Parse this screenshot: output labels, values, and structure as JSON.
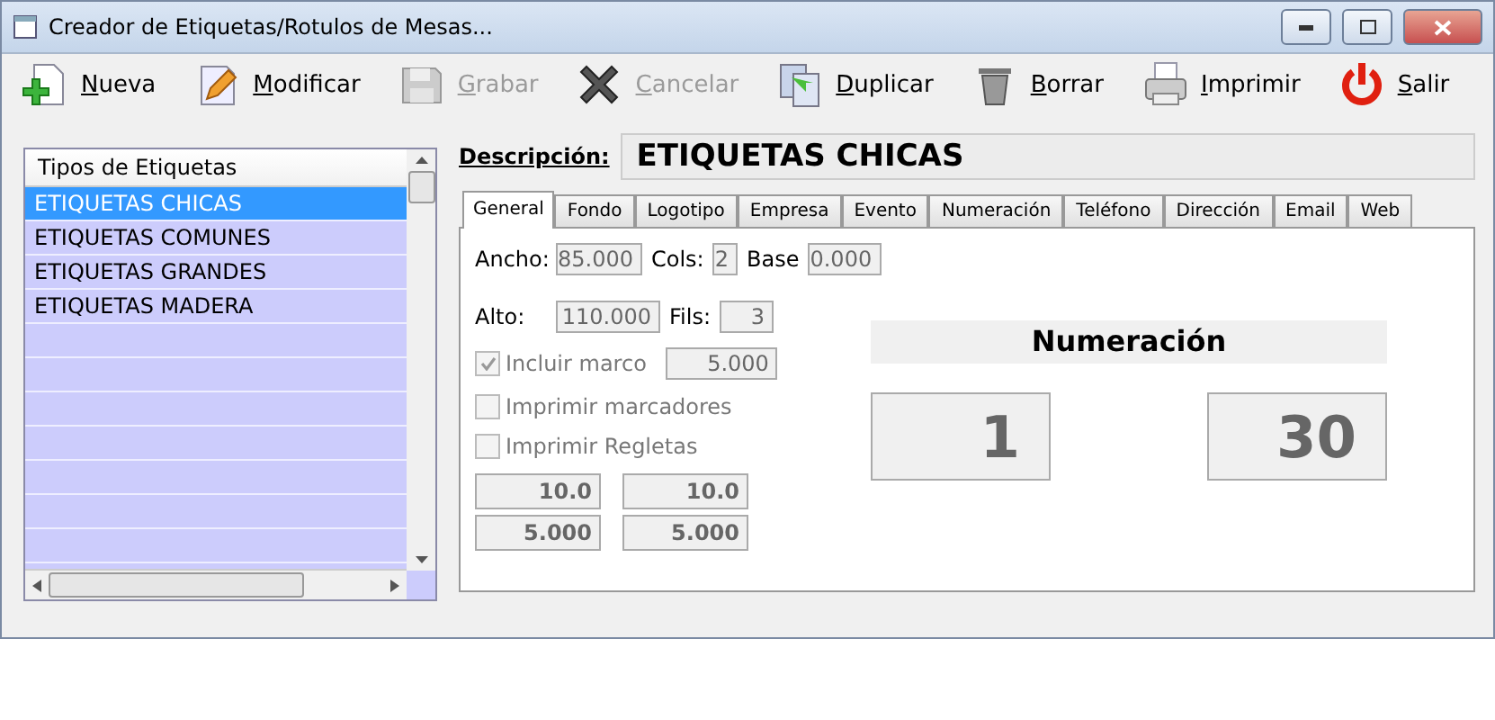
{
  "window": {
    "title": "Creador de Etiquetas/Rotulos de Mesas..."
  },
  "toolbar": [
    {
      "kind": "new",
      "label": "Nueva",
      "disabled": false
    },
    {
      "kind": "edit",
      "label": "Modificar",
      "disabled": false
    },
    {
      "kind": "save",
      "label": "Grabar",
      "disabled": true
    },
    {
      "kind": "cancel",
      "label": "Cancelar",
      "disabled": true
    },
    {
      "kind": "duplicate",
      "label": "Duplicar",
      "disabled": false
    },
    {
      "kind": "delete",
      "label": "Borrar",
      "disabled": false
    },
    {
      "kind": "print",
      "label": "Imprimir",
      "disabled": false
    },
    {
      "kind": "exit",
      "label": "Salir",
      "disabled": false
    }
  ],
  "label_types": {
    "header": "Tipos de Etiquetas",
    "rows": [
      {
        "text": "ETIQUETAS CHICAS",
        "selected": true
      },
      {
        "text": "ETIQUETAS COMUNES",
        "selected": false
      },
      {
        "text": "ETIQUETAS GRANDES",
        "selected": false
      },
      {
        "text": "ETIQUETAS MADERA",
        "selected": false
      }
    ]
  },
  "description": {
    "label": "Descripción:",
    "value": "ETIQUETAS CHICAS"
  },
  "tabs": [
    {
      "label": "General",
      "selected": true
    },
    {
      "label": "Fondo",
      "selected": false
    },
    {
      "label": "Logotipo",
      "selected": false
    },
    {
      "label": "Empresa",
      "selected": false
    },
    {
      "label": "Evento",
      "selected": false
    },
    {
      "label": "Numeración",
      "selected": false
    },
    {
      "label": "Teléfono",
      "selected": false
    },
    {
      "label": "Dirección",
      "selected": false
    },
    {
      "label": "Email",
      "selected": false
    },
    {
      "label": "Web",
      "selected": false
    }
  ],
  "general": {
    "ancho": {
      "label": "Ancho:",
      "value": "85.000"
    },
    "cols": {
      "label": "Cols:",
      "value": "2"
    },
    "base": {
      "label": "Base",
      "value": "0.000"
    },
    "alto": {
      "label": "Alto:",
      "value": "110.000"
    },
    "fils": {
      "label": "Fils:",
      "value": "3"
    },
    "checks": [
      {
        "label": "Incluir marco",
        "checked": true,
        "disabled": true,
        "value": "5.000"
      },
      {
        "label": "Imprimir marcadores",
        "checked": false,
        "disabled": true
      },
      {
        "label": "Imprimir Regletas",
        "checked": false,
        "disabled": true
      }
    ],
    "margins": [
      "10.0",
      "10.0",
      "5.000",
      "5.000"
    ],
    "numbering": {
      "title": "Numeración",
      "from": "1",
      "to": "30"
    }
  }
}
